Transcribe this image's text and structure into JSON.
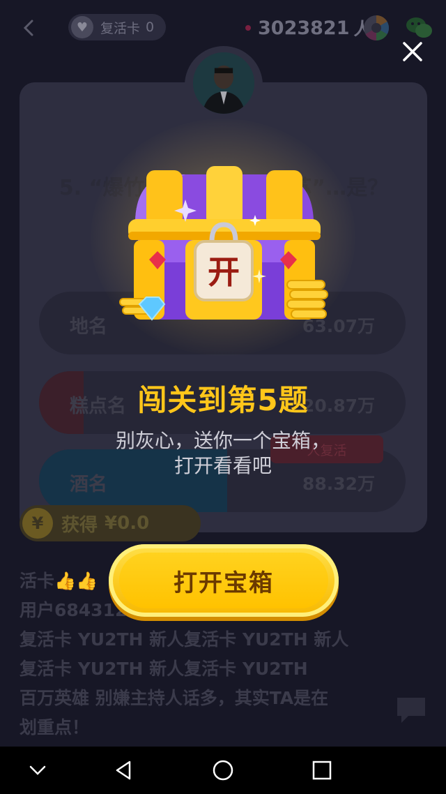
{
  "topbar": {
    "revive_label": "复活卡",
    "revive_count": "0",
    "viewer_count": "3023821",
    "viewer_unit": "人"
  },
  "question": {
    "text": "5. “爆竹声…阖送暖入居苏”…是？"
  },
  "options": [
    {
      "label": "地名",
      "value": "63.07万"
    },
    {
      "label": "糕点名",
      "value": "20.87万"
    },
    {
      "label": "酒名",
      "value": "88.32万"
    }
  ],
  "revive_tag": "人复活",
  "earn": {
    "label": "获得",
    "value": "¥0.0"
  },
  "chat": [
    "活卡👍👍",
    "用户684312…新人",
    "复活卡 YU2TH 新人复活卡 YU2TH 新人",
    "复活卡 YU2TH 新人复活卡 YU2TH",
    "百万英雄 别嫌主持人话多，其实TA是在",
    "划重点！"
  ],
  "overlay": {
    "chest_lock_char": "开",
    "title": "闯关到第5题",
    "subtitle_line1": "别灰心，送你一个宝箱，",
    "subtitle_line2": "打开看看吧",
    "button_label": "打开宝箱"
  },
  "colors": {
    "background": "#171726",
    "accent_yellow": "#ffc61a",
    "button_text": "#6b3a00"
  },
  "icons": [
    "back-icon",
    "heart-icon",
    "share-icon",
    "wechat-icon",
    "close-icon",
    "chat-bubble-icon",
    "nav-back-icon",
    "nav-home-icon",
    "nav-recents-icon",
    "nav-collapse-icon"
  ]
}
